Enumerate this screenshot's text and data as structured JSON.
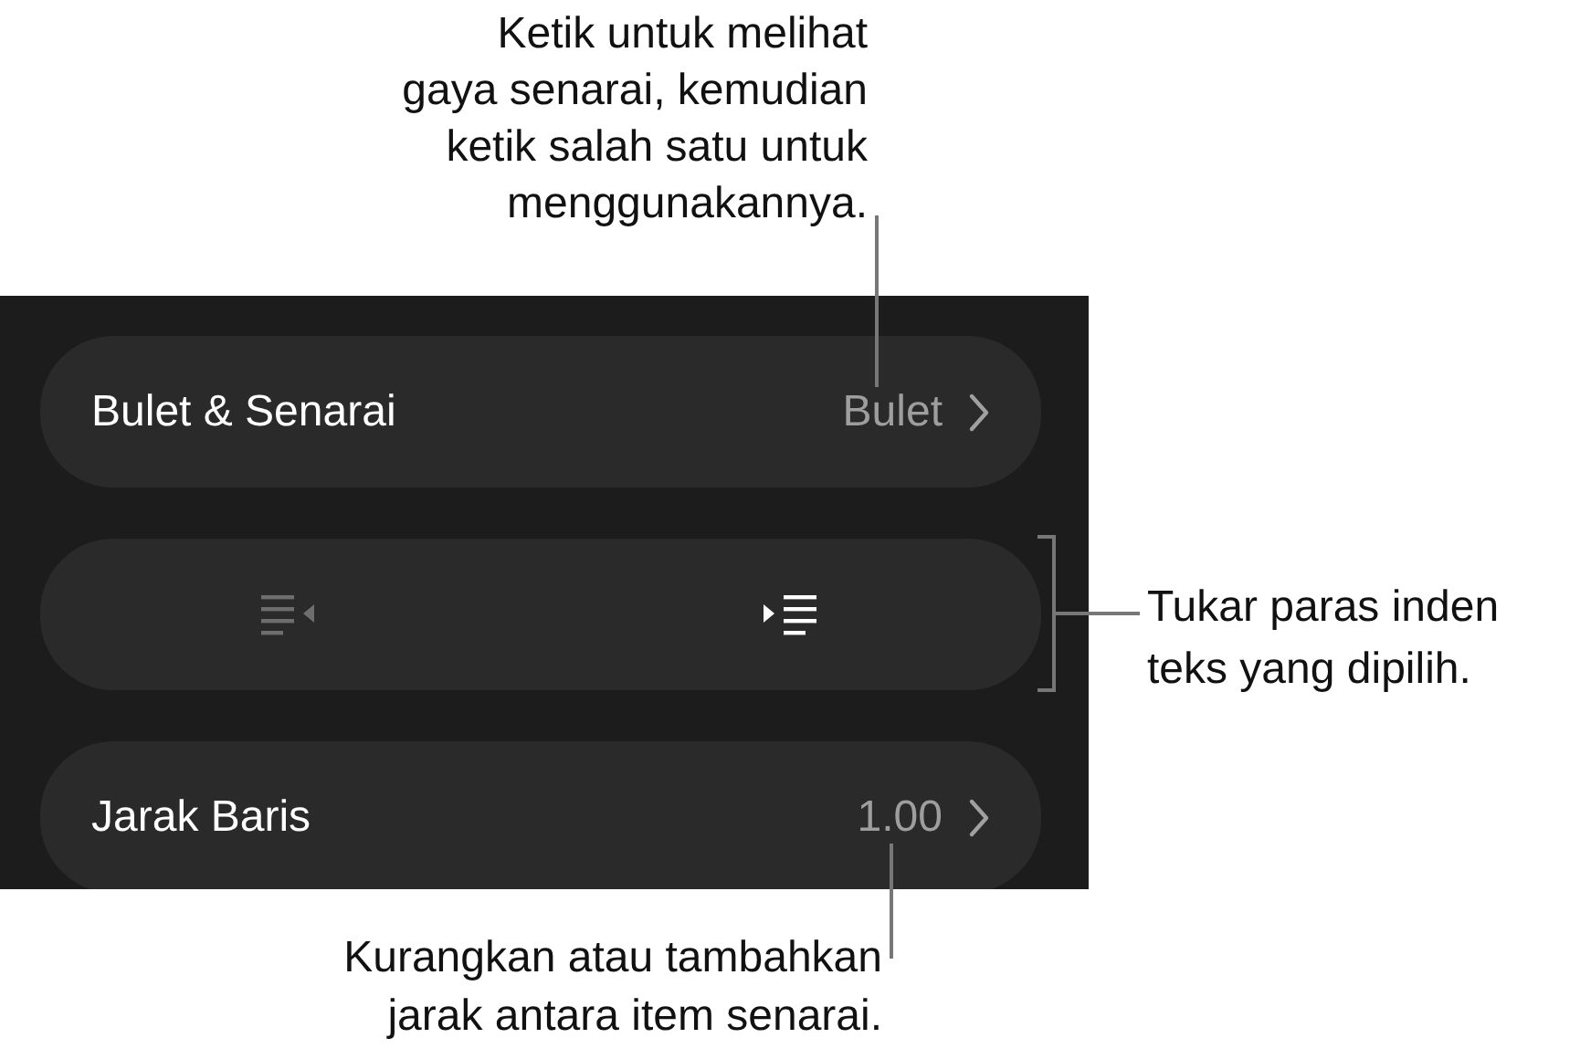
{
  "panel": {
    "rows": [
      {
        "kind": "disclosure",
        "label": "Bulet & Senarai",
        "value": "Bulet"
      },
      {
        "kind": "indent",
        "buttons": [
          {
            "kind": "decrease",
            "disabled": true
          },
          {
            "kind": "increase",
            "disabled": false
          }
        ]
      },
      {
        "kind": "disclosure",
        "label": "Jarak Baris",
        "value": "1.00"
      }
    ]
  },
  "callouts": [
    {
      "kind": "top",
      "lines": [
        "Ketik untuk melihat",
        "gaya senarai, kemudian",
        "ketik salah satu untuk",
        "menggunakannya."
      ]
    },
    {
      "kind": "right",
      "lines": [
        "Tukar paras inden",
        "teks yang dipilih."
      ]
    },
    {
      "kind": "bottom",
      "lines": [
        "Kurangkan atau tambahkan",
        "jarak antara item senarai."
      ]
    }
  ]
}
